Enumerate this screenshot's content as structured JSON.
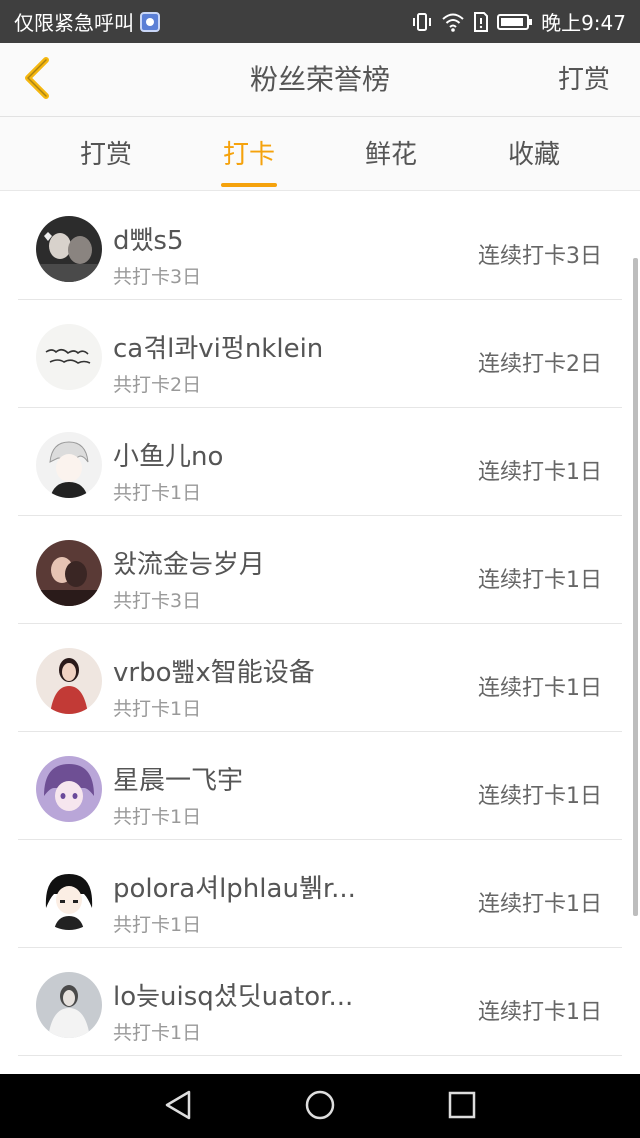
{
  "status_bar": {
    "emergency_text": "仅限紧急呼叫",
    "app_badge_icon": "music-app-icon",
    "time": "晚上9:47",
    "icons": [
      "vibrate-icon",
      "wifi-icon",
      "sim-alert-icon",
      "battery-icon"
    ]
  },
  "header": {
    "back_icon": "chevron-left-icon",
    "title": "粉丝荣誉榜",
    "action": "打赏",
    "accent_color": "#f5a20c"
  },
  "tabs": [
    {
      "label": "打赏",
      "active": false
    },
    {
      "label": "打卡",
      "active": true
    },
    {
      "label": "鲜花",
      "active": false
    },
    {
      "label": "收藏",
      "active": false
    }
  ],
  "list": [
    {
      "name": "d뺐s5",
      "total": "共打卡3日",
      "streak": "连续打卡3日"
    },
    {
      "name": "ca겪l콰vi펑nklein",
      "total": "共打卡2日",
      "streak": "连续打卡2日"
    },
    {
      "name": "小鱼儿no",
      "total": "共打卡1日",
      "streak": "连续打卡1日"
    },
    {
      "name": "왔流金능岁月",
      "total": "共打卡3日",
      "streak": "连续打卡1日"
    },
    {
      "name": "vrbo뾆x智能设备",
      "total": "共打卡1日",
      "streak": "连续打卡1日"
    },
    {
      "name": "星晨一飞宇",
      "total": "共打卡1日",
      "streak": "连续打卡1日"
    },
    {
      "name": "polora셔lphlau뷁r...",
      "total": "共打卡1日",
      "streak": "连续打卡1日"
    },
    {
      "name": "lo늦uisq셨딧uator...",
      "total": "共打卡1日",
      "streak": "连续打卡1日"
    }
  ],
  "nav_bar": {
    "icons": [
      "back-triangle-icon",
      "home-circle-icon",
      "recents-square-icon"
    ]
  }
}
